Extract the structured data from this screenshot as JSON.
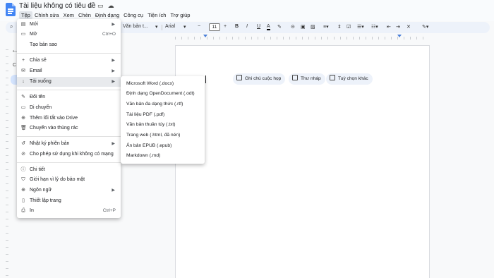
{
  "app": {
    "title": "Tài liệu không có tiêu đề",
    "title_icons": [
      {
        "name": "star-icon",
        "glyph": "☆"
      },
      {
        "name": "move-folder-icon",
        "glyph": "▭"
      },
      {
        "name": "cloud-status-icon",
        "glyph": "☁"
      }
    ]
  },
  "menubar": [
    "Tệp",
    "Chỉnh sửa",
    "Xem",
    "Chèn",
    "Định dạng",
    "Công cụ",
    "Tiện ích",
    "Trợ giúp"
  ],
  "toolbar": {
    "style_label": "Văn bản t...",
    "font_label": "Arial",
    "font_size": "11",
    "bold": "B",
    "italic": "I",
    "underline": "U",
    "text_color": "A"
  },
  "sidebar": {
    "partial_label": "C"
  },
  "file_menu": {
    "items": [
      {
        "name": "new",
        "icon": "▤",
        "label": "Mới",
        "shortcut": "",
        "submenu": true
      },
      {
        "name": "open",
        "icon": "▭",
        "label": "Mở",
        "shortcut": "Ctrl+O",
        "submenu": false
      },
      {
        "name": "make-copy",
        "icon": "",
        "label": "Tạo bản sao",
        "shortcut": "",
        "submenu": false
      },
      {
        "name": "share",
        "icon": "+",
        "label": "Chia sẻ",
        "shortcut": "",
        "submenu": true
      },
      {
        "name": "email",
        "icon": "✉",
        "label": "Email",
        "shortcut": "",
        "submenu": true
      },
      {
        "name": "download",
        "icon": "↓",
        "label": "Tải xuống",
        "shortcut": "",
        "submenu": true
      },
      {
        "name": "rename",
        "icon": "✎",
        "label": "Đổi tên",
        "shortcut": "",
        "submenu": false
      },
      {
        "name": "move",
        "icon": "▭",
        "label": "Di chuyển",
        "shortcut": "",
        "submenu": false
      },
      {
        "name": "add-shortcut",
        "icon": "⊕",
        "label": "Thêm lối tắt vào Drive",
        "shortcut": "",
        "submenu": false
      },
      {
        "name": "move-to-trash",
        "icon": "🗑",
        "label": "Chuyển vào thùng rác",
        "shortcut": "",
        "submenu": false
      },
      {
        "name": "version-history",
        "icon": "↺",
        "label": "Nhật ký phiên bản",
        "shortcut": "",
        "submenu": true
      },
      {
        "name": "offline",
        "icon": "⊘",
        "label": "Cho phép sử dụng khi không có mạng",
        "shortcut": "",
        "submenu": false
      },
      {
        "name": "details",
        "icon": "ⓘ",
        "label": "Chi tiết",
        "shortcut": "",
        "submenu": false
      },
      {
        "name": "security-limits",
        "icon": "⛉",
        "label": "Giới hạn vì lý do bảo mật",
        "shortcut": "",
        "submenu": false
      },
      {
        "name": "language",
        "icon": "⊕",
        "label": "Ngôn ngữ",
        "shortcut": "",
        "submenu": true
      },
      {
        "name": "page-setup",
        "icon": "▯",
        "label": "Thiết lập trang",
        "shortcut": "",
        "submenu": false
      },
      {
        "name": "print",
        "icon": "⎙",
        "label": "In",
        "shortcut": "Ctrl+P",
        "submenu": false
      }
    ]
  },
  "download_submenu": {
    "items": [
      "Microsoft Word (.docx)",
      "Định dạng OpenDocument (.odt)",
      "Văn bản đa dạng thức (.rtf)",
      "Tài liệu PDF (.pdf)",
      "Văn bản thuần túy (.txt)",
      "Trang web (.html, đã nén)",
      "Ấn bản EPUB (.epub)",
      "Markdown (.md)"
    ]
  },
  "chips": [
    {
      "name": "meeting-notes-chip",
      "icon": "meeting-notes-icon",
      "label": "Ghi chú cuộc họp"
    },
    {
      "name": "email-draft-chip",
      "icon": "email-draft-icon",
      "label": "Thư nháp"
    },
    {
      "name": "more-options-chip",
      "icon": "more-options-icon",
      "label": "Tuỳ chọn khác"
    }
  ],
  "colors": {
    "accent": "#4285f4",
    "toolbar_bg": "#edf2fa",
    "menu_hover": "#e8eaed"
  }
}
